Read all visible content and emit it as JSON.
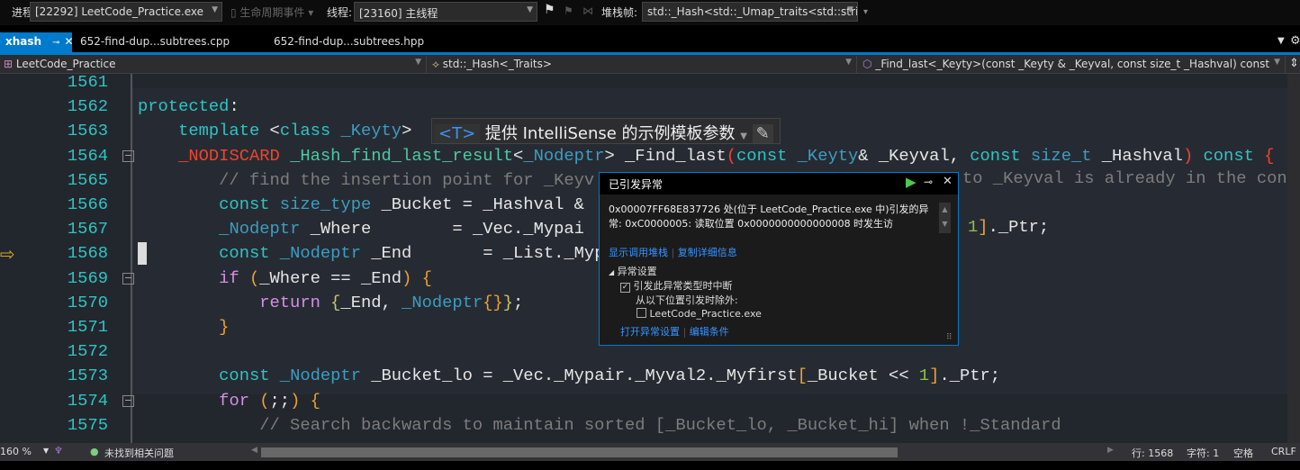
{
  "toolbar": {
    "process_label": "进程:",
    "process_value": "[22292] LeetCode_Practice.exe",
    "lifecycle_label": "生命周期事件",
    "thread_label": "线程:",
    "thread_value": "[23160] 主线程",
    "stackframe_label": "堆栈帧:",
    "stackframe_value": "std::_Hash<std::_Umap_traits<std::strir"
  },
  "tabs": [
    {
      "label": "xhash",
      "active": true
    },
    {
      "label": "652-find-dup...subtrees.cpp"
    },
    {
      "label": "652-find-dup...subtrees.hpp"
    }
  ],
  "nav": {
    "project": "LeetCode_Practice",
    "scope": "std::_Hash<_Traits>",
    "member": "_Find_last<_Keyty>(const _Keyty & _Keyval, const size_t _Hashval) const"
  },
  "intellisense": {
    "badge": "<T>",
    "text": "提供 IntelliSense 的示例模板参数"
  },
  "code": {
    "line_numbers": [
      "1561",
      "1562",
      "1563",
      "1564",
      "1565",
      "1566",
      "1567",
      "1568",
      "1569",
      "1570",
      "1571",
      "1572",
      "1573",
      "1574",
      "1575"
    ],
    "lines": [
      [],
      [
        [
          "protected",
          "kw"
        ],
        [
          ":",
          "id"
        ]
      ],
      [
        [
          "    template ",
          "kw"
        ],
        [
          "<",
          "id"
        ],
        [
          "class ",
          "kw"
        ],
        [
          "_Keyty",
          "ty"
        ],
        [
          ">",
          "id"
        ]
      ],
      [
        [
          "    ",
          "id"
        ],
        [
          "_NODISCARD",
          "red"
        ],
        [
          " _Hash_find_last_result",
          "fn"
        ],
        [
          "<",
          "id"
        ],
        [
          "_Nodeptr",
          "ty"
        ],
        [
          "> _Find_last",
          "id"
        ],
        [
          "(",
          "red"
        ],
        [
          "const ",
          "kw"
        ],
        [
          "_Keyty",
          "ty"
        ],
        [
          "& _Keyval, ",
          "id"
        ],
        [
          "const ",
          "kw"
        ],
        [
          "size_t",
          "ty"
        ],
        [
          " _Hashval",
          "id"
        ],
        [
          ")",
          "red"
        ],
        [
          " const ",
          "kw"
        ],
        [
          "{",
          "red"
        ]
      ],
      [
        [
          "        // find the insertion point for _Keyv",
          "cm"
        ]
      ],
      [
        [
          "        const ",
          "kw"
        ],
        [
          "size_type",
          "ty"
        ],
        [
          " _Bucket = _Hashval &",
          "id"
        ]
      ],
      [
        [
          "        ",
          "id"
        ],
        [
          "_Nodeptr",
          "ty"
        ],
        [
          " _Where        = _Vec._Mypai",
          "id"
        ]
      ],
      [
        [
          "        const ",
          "kw"
        ],
        [
          "_Nodeptr",
          "ty"
        ],
        [
          " _End       = _List._Mypa",
          "id"
        ]
      ],
      [
        [
          "        ",
          "id"
        ],
        [
          "if",
          "ctl"
        ],
        [
          " (",
          "br"
        ],
        [
          "_Where == _End",
          "id"
        ],
        [
          ")",
          "br"
        ],
        [
          " {",
          "br"
        ]
      ],
      [
        [
          "            ",
          "id"
        ],
        [
          "return",
          "ctl"
        ],
        [
          " {",
          "br2"
        ],
        [
          "_End, ",
          "id"
        ],
        [
          "_Nodeptr",
          "ty"
        ],
        [
          "{}",
          "br"
        ],
        [
          "}",
          "br2"
        ],
        [
          ";",
          "id"
        ]
      ],
      [
        [
          "        }",
          "br"
        ]
      ],
      [],
      [
        [
          "        const ",
          "kw"
        ],
        [
          "_Nodeptr",
          "ty"
        ],
        [
          " _Bucket_lo = _Vec._Mypair._Myval2._Myfirst",
          "id"
        ],
        [
          "[",
          "br"
        ],
        [
          "_Bucket << ",
          "id"
        ],
        [
          "1",
          "num"
        ],
        [
          "]",
          "br"
        ],
        [
          "._Ptr;",
          "id"
        ]
      ],
      [
        [
          "        ",
          "id"
        ],
        [
          "for",
          "ctl"
        ],
        [
          " (",
          "br"
        ],
        [
          ";;",
          "id"
        ],
        [
          ")",
          "br"
        ],
        [
          " {",
          "br"
        ]
      ],
      [
        [
          "            // Search backwards to maintain sorted [_Bucket_lo, _Bucket_hi] when !_Standard",
          "cm"
        ]
      ]
    ],
    "right_1565": "to _Keyval is already in the con",
    "right_1567_num": "1",
    "right_1567_rest": "._Ptr;"
  },
  "exception": {
    "title": "已引发异常",
    "message": "0x00007FF68E837726 处(位于 LeetCode_Practice.exe 中)引发的异常: 0xC0000005: 读取位置 0x0000000000000008 时发生访",
    "show_call_stack": "显示调用堆栈",
    "copy_details": "复制详细信息",
    "settings_header": "异常设置",
    "break_when_thrown": "引发此异常类型时中断",
    "except_from": "从以下位置引发时除外:",
    "module": "LeetCode_Practice.exe",
    "open_settings": "打开异常设置",
    "edit_conditions": "编辑条件",
    "break_checked": true,
    "module_checked": false
  },
  "status": {
    "zoom": "160 %",
    "issues": "未找到相关问题",
    "line": "行: 1568",
    "char": "字符: 1",
    "spaces": "空格",
    "eol": "CRLF"
  },
  "colors": {
    "accent": "#007acc",
    "link": "#3794ff",
    "editor_bg": "#22272e"
  }
}
